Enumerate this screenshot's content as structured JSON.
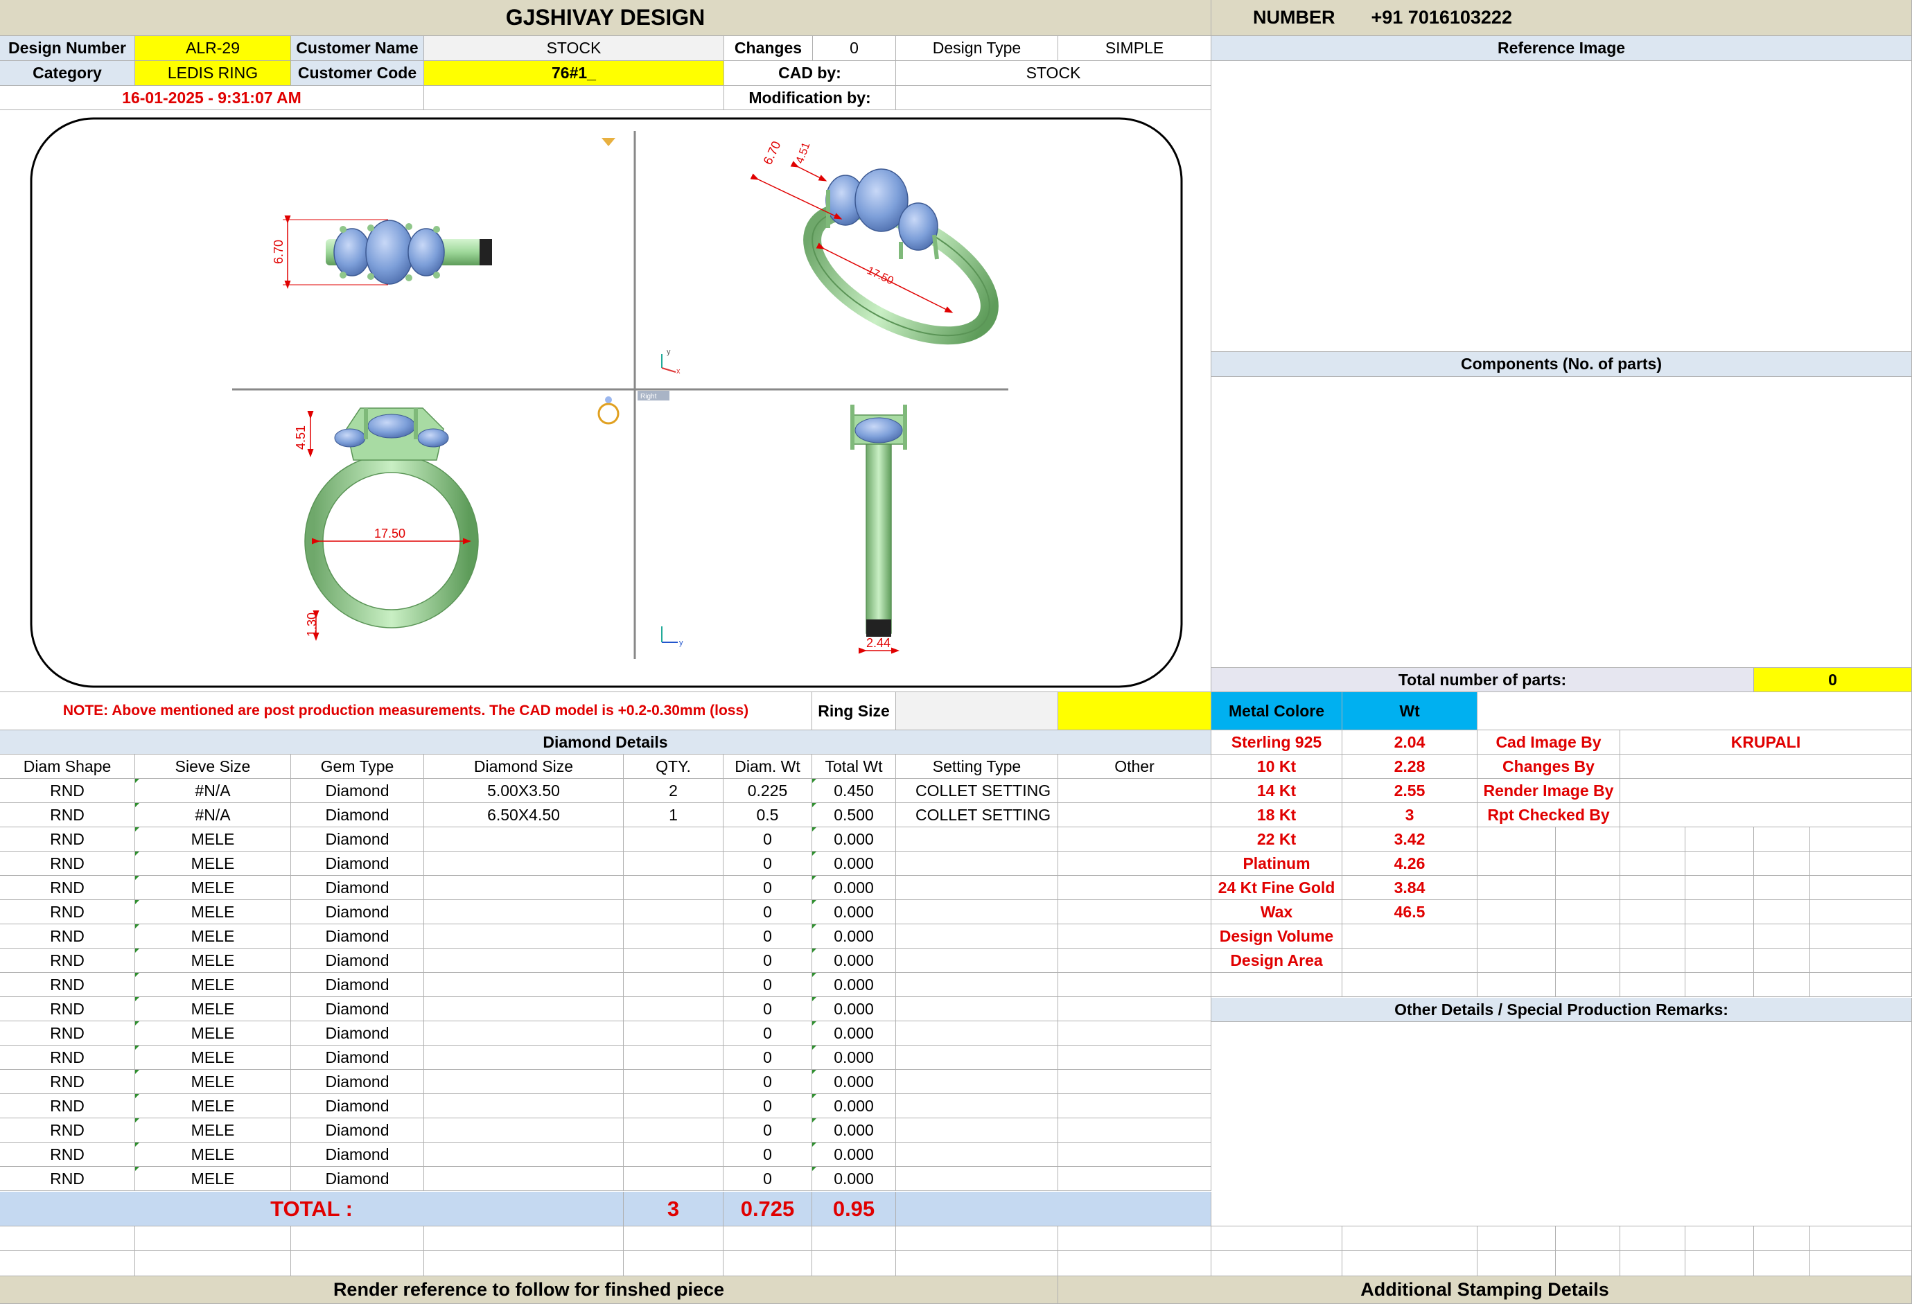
{
  "header": {
    "title": "GJSHIVAY DESIGN",
    "number_label": "NUMBER",
    "number_value": "+91 7016103222"
  },
  "info": {
    "design_number_label": "Design Number",
    "design_number": "ALR-29",
    "customer_name_label": "Customer Name",
    "customer_name": "STOCK",
    "changes_label": "Changes",
    "changes": "0",
    "design_type_label": "Design Type",
    "design_type": "SIMPLE",
    "category_label": "Category",
    "category": "LEDIS RING",
    "customer_code_label": "Customer Code",
    "customer_code": "76#1_",
    "cad_by_label": "CAD by:",
    "cad_by": "STOCK",
    "datetime": "16-01-2025 - 9:31:07 AM",
    "modification_label": "Modification by:"
  },
  "right_panel": {
    "reference_image": "Reference Image",
    "components": "Components (No. of parts)",
    "total_parts_label": "Total number of parts:",
    "total_parts": "0",
    "metal_colore": "Metal Colore",
    "wt": "Wt",
    "other_details": "Other Details / Special Production Remarks:",
    "additional_stamping": "Additional Stamping Details"
  },
  "cad": {
    "dims": {
      "top_height": "6.70",
      "iso_6_70": "6.70",
      "iso_4_51": "4.51",
      "iso_17_50": "17.50",
      "front_4_51": "4.51",
      "front_17_50": "17.50",
      "front_1_30": "1.30",
      "side_2_44": "2.44"
    },
    "viewport_label": "Right"
  },
  "note": "NOTE: Above mentioned are post production measurements. The CAD model is +0.2-0.30mm (loss)",
  "ring_size_label": "Ring Size",
  "diamond": {
    "title": "Diamond Details",
    "columns": [
      "Diam Shape",
      "Sieve Size",
      "Gem Type",
      "Diamond Size",
      "QTY.",
      "Diam. Wt",
      "Total Wt",
      "Setting Type",
      "Other"
    ],
    "rows": [
      [
        "RND",
        "#N/A",
        "Diamond",
        "5.00X3.50",
        "2",
        "0.225",
        "0.450",
        "COLLET SETTING",
        ""
      ],
      [
        "RND",
        "#N/A",
        "Diamond",
        "6.50X4.50",
        "1",
        "0.5",
        "0.500",
        "COLLET SETTING",
        ""
      ],
      [
        "RND",
        "MELE",
        "Diamond",
        "",
        "",
        "0",
        "0.000",
        "",
        ""
      ],
      [
        "RND",
        "MELE",
        "Diamond",
        "",
        "",
        "0",
        "0.000",
        "",
        ""
      ],
      [
        "RND",
        "MELE",
        "Diamond",
        "",
        "",
        "0",
        "0.000",
        "",
        ""
      ],
      [
        "RND",
        "MELE",
        "Diamond",
        "",
        "",
        "0",
        "0.000",
        "",
        ""
      ],
      [
        "RND",
        "MELE",
        "Diamond",
        "",
        "",
        "0",
        "0.000",
        "",
        ""
      ],
      [
        "RND",
        "MELE",
        "Diamond",
        "",
        "",
        "0",
        "0.000",
        "",
        ""
      ],
      [
        "RND",
        "MELE",
        "Diamond",
        "",
        "",
        "0",
        "0.000",
        "",
        ""
      ],
      [
        "RND",
        "MELE",
        "Diamond",
        "",
        "",
        "0",
        "0.000",
        "",
        ""
      ],
      [
        "RND",
        "MELE",
        "Diamond",
        "",
        "",
        "0",
        "0.000",
        "",
        ""
      ],
      [
        "RND",
        "MELE",
        "Diamond",
        "",
        "",
        "0",
        "0.000",
        "",
        ""
      ],
      [
        "RND",
        "MELE",
        "Diamond",
        "",
        "",
        "0",
        "0.000",
        "",
        ""
      ],
      [
        "RND",
        "MELE",
        "Diamond",
        "",
        "",
        "0",
        "0.000",
        "",
        ""
      ],
      [
        "RND",
        "MELE",
        "Diamond",
        "",
        "",
        "0",
        "0.000",
        "",
        ""
      ],
      [
        "RND",
        "MELE",
        "Diamond",
        "",
        "",
        "0",
        "0.000",
        "",
        ""
      ],
      [
        "RND",
        "MELE",
        "Diamond",
        "",
        "",
        "0",
        "0.000",
        "",
        ""
      ]
    ],
    "total_label": "TOTAL :",
    "total_qty": "3",
    "total_diam_wt": "0.725",
    "total_wt": "0.95"
  },
  "metals": [
    [
      "Sterling 925",
      "2.04"
    ],
    [
      "10 Kt",
      "2.28"
    ],
    [
      "14 Kt",
      "2.55"
    ],
    [
      "18 Kt",
      "3"
    ],
    [
      "22 Kt",
      "3.42"
    ],
    [
      "Platinum",
      "4.26"
    ],
    [
      "24 Kt Fine Gold",
      "3.84"
    ],
    [
      "Wax",
      "46.5"
    ],
    [
      "Design Volume",
      ""
    ],
    [
      "Design Area",
      ""
    ]
  ],
  "staff": [
    [
      "Cad Image By",
      "KRUPALI"
    ],
    [
      "Changes By",
      ""
    ],
    [
      "Render Image By",
      ""
    ],
    [
      "Rpt Checked By",
      ""
    ]
  ],
  "footer": {
    "render_reference": "Render reference to follow for finshed piece"
  }
}
